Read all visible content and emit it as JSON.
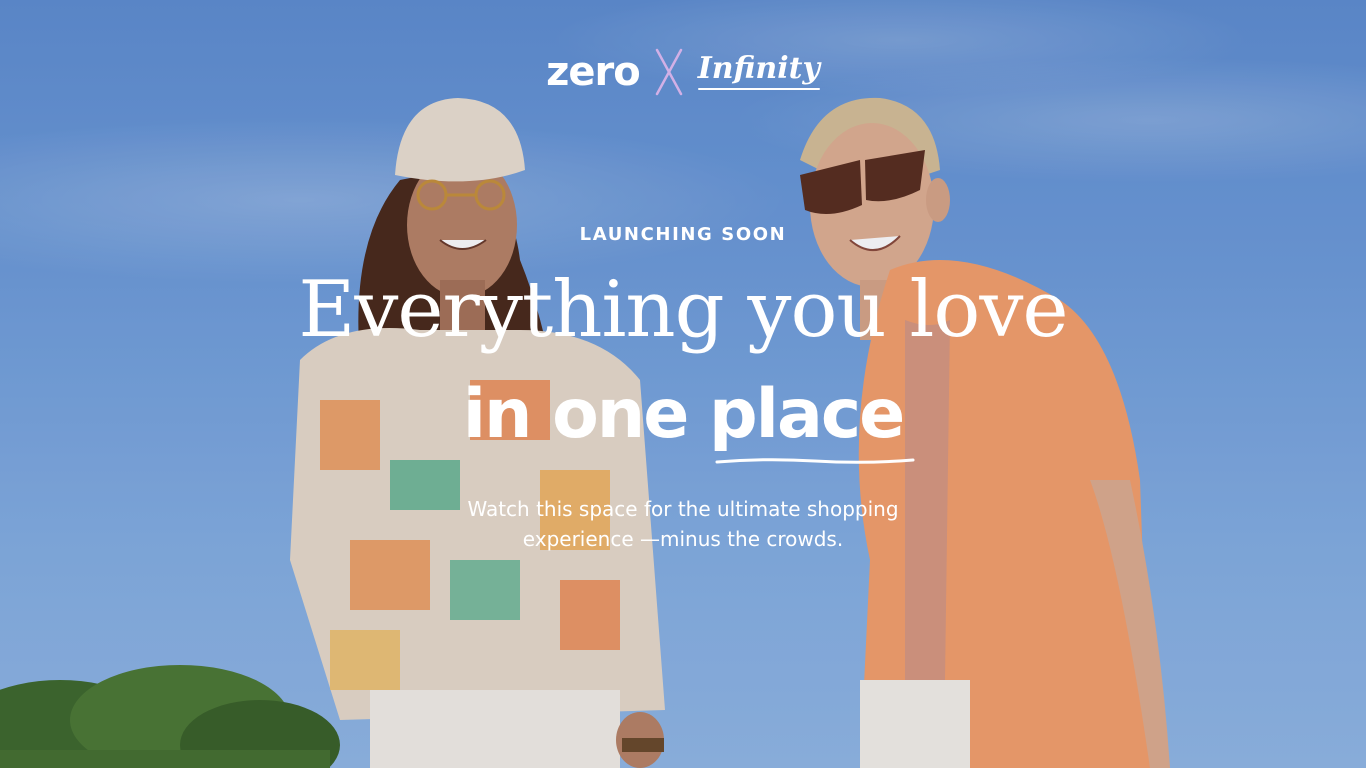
{
  "brand": {
    "logo_left": "zero",
    "separator": "X",
    "logo_right": "Infinity"
  },
  "hero": {
    "eyebrow": "LAUNCHING SOON",
    "headline_line1": "Everything you love",
    "headline_line2_prefix": "in one ",
    "headline_line2_accent": "place",
    "subcopy_line1": "Watch this space for the ultimate shopping",
    "subcopy_line2": "experience —minus the crowds."
  },
  "colors": {
    "sky": "#6e9ddb",
    "text": "#ffffff",
    "separator_accent": "#d2b0e6"
  }
}
